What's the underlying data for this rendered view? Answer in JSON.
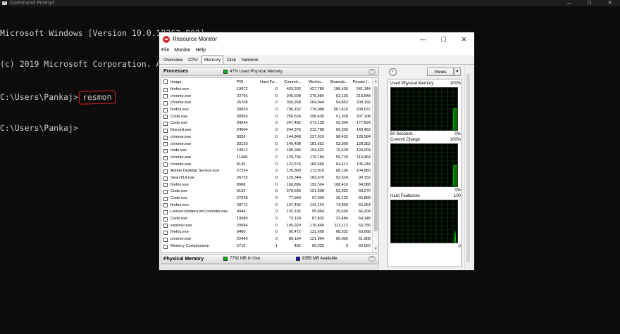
{
  "cmd": {
    "title": "Command Prompt",
    "controls": [
      "—",
      "☐",
      "✕"
    ],
    "lines": [
      "Microsoft Windows [Version 10.0.18363.900]",
      "(c) 2019 Microsoft Corporation. All rights reserved."
    ],
    "prompt1": "C:\\Users\\Pankaj>",
    "command": "resmon",
    "prompt2": "C:\\Users\\Pankaj>"
  },
  "resmon": {
    "title": "Resource Monitor",
    "window_controls": [
      "—",
      "☐",
      "✕"
    ],
    "menu": [
      "File",
      "Monitor",
      "Help"
    ],
    "tabs": [
      "Overview",
      "CPU",
      "Memory",
      "Disk",
      "Network"
    ],
    "active_tab": "Memory",
    "processes": {
      "title": "Processes",
      "legend": "47% Used Physical Memory",
      "legend_color": "#00c000",
      "columns": [
        "Image",
        "PID",
        "Hard Fa...",
        "Commit...",
        "Workin...",
        "Shareab...",
        "Private (..."
      ],
      "rows": [
        [
          "firefox.exe",
          "19972",
          "0",
          "403,292",
          "427,780",
          "186,436",
          "241,344"
        ],
        [
          "chrome.exe",
          "22756",
          "0",
          "245,608",
          "276,984",
          "63,136",
          "213,848"
        ],
        [
          "chrome.exe",
          "26708",
          "0",
          "350,268",
          "264,044",
          "54,852",
          "209,192"
        ],
        [
          "firefox.exe",
          "30820",
          "0",
          "796,152",
          "776,088",
          "567,416",
          "208,672"
        ],
        [
          "Code.exe",
          "30956",
          "0",
          "250,624",
          "258,436",
          "51,328",
          "207,108"
        ],
        [
          "Code.exe",
          "34244",
          "0",
          "247,492",
          "271,128",
          "93,304",
          "177,824"
        ],
        [
          "Discord.exe",
          "24004",
          "0",
          "244,376",
          "212,788",
          "69,336",
          "143,452"
        ],
        [
          "chrome.exe",
          "8020",
          "0",
          "144,848",
          "227,016",
          "98,432",
          "128,584"
        ],
        [
          "chrome.exe",
          "33120",
          "0",
          "145,408",
          "181,652",
          "53,300",
          "128,352"
        ],
        [
          "node.exe",
          "19912",
          "0",
          "185,996",
          "194,632",
          "70,628",
          "124,004"
        ],
        [
          "chrome.exe",
          "11468",
          "0",
          "129,796",
          "170,184",
          "59,720",
          "110,464"
        ],
        [
          "chrome.exe",
          "8136",
          "0",
          "122,576",
          "169,656",
          "64,412",
          "105,244"
        ],
        [
          "Adobe Desktop Service.exe",
          "27324",
          "0",
          "126,880",
          "173,016",
          "68,136",
          "104,880"
        ],
        [
          "SearchUI.exe",
          "26732",
          "0",
          "120,344",
          "183,676",
          "93,524",
          "90,152"
        ],
        [
          "firefox.exe",
          "8968",
          "0",
          "160,896",
          "192,504",
          "108,416",
          "84,088"
        ],
        [
          "Code.exe",
          "6132",
          "0",
          "279,596",
          "121,608",
          "53,332",
          "68,276"
        ],
        [
          "Code.exe",
          "27028",
          "0",
          "77,940",
          "97,000",
          "30,132",
          "66,868"
        ],
        [
          "firefox.exe",
          "28712",
          "0",
          "107,432",
          "141,124",
          "74,860",
          "66,264"
        ],
        [
          "Lenovo.Modern.ImController.exe",
          "4944",
          "0",
          "132,192",
          "95,864",
          "29,660",
          "66,204"
        ],
        [
          "Code.exe",
          "19380",
          "0",
          "73,124",
          "87,832",
          "23,484",
          "64,348"
        ],
        [
          "explorer.exe",
          "20664",
          "0",
          "105,920",
          "176,868",
          "113,112",
          "63,756"
        ],
        [
          "firefox.exe",
          "9400",
          "0",
          "90,472",
          "131,600",
          "68,532",
          "63,068"
        ],
        [
          "chrome.exe",
          "22440",
          "0",
          "80,164",
          "121,964",
          "60,056",
          "61,908"
        ],
        [
          "Memory Compression",
          "2716",
          "1",
          "432",
          "60,920",
          "0",
          "60,920"
        ]
      ]
    },
    "physical": {
      "title": "Physical Memory",
      "in_use": "7792 MB In Use",
      "in_use_color": "#00c000",
      "available": "8355 MB Available",
      "available_color": "#1010d0"
    },
    "views_label": "Views",
    "graphs": [
      {
        "title": "Used Physical Memory",
        "max": "100%",
        "left": "60 Seconds",
        "min": "0%"
      },
      {
        "title": "Commit Charge",
        "max": "100%",
        "left": "",
        "min": "0%"
      },
      {
        "title": "Hard Faults/sec",
        "max": "100",
        "left": "",
        "min": "0"
      }
    ],
    "graph_color": "#00c000"
  }
}
